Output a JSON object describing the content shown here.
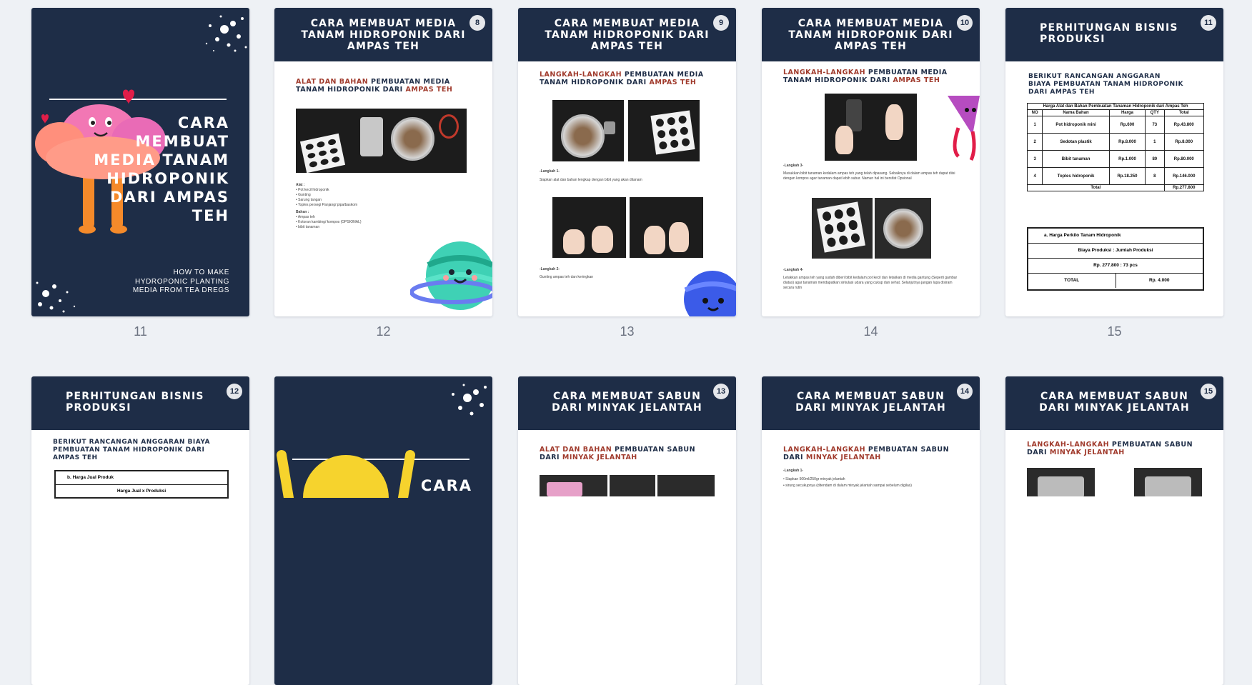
{
  "colors": {
    "navy": "#1e2d47",
    "accent_red": "#a03a2c",
    "background": "#eef1f5"
  },
  "page_numbers": [
    "11",
    "12",
    "13",
    "14",
    "15"
  ],
  "row1": {
    "cover": {
      "title_lines": [
        "CARA",
        "MEMBUAT",
        "MEDIA TANAM",
        "HIDROPONIK",
        "DARI AMPAS",
        "TEH"
      ],
      "subtitle_lines": [
        "HOW TO MAKE",
        "HYDROPONIC PLANTING",
        "MEDIA FROM TEA DREGS"
      ]
    },
    "p12": {
      "badge": "8",
      "title": "CARA MEMBUAT MEDIA TANAM HIDROPONIK DARI AMPAS TEH",
      "sub_red1": "ALAT DAN BAHAN",
      "sub_plain": " PEMBUATAN MEDIA TANAM HIDROPONIK DARI ",
      "sub_red2": "AMPAS TEH",
      "alat_label": "Alat :",
      "alat_items": [
        "• Pot kecil hidroponik",
        "• Gunting",
        "• Sarung tangan",
        "• Toples persegi Panjang/ pipa/baskom"
      ],
      "bahan_label": "Bahan :",
      "bahan_items": [
        "• Ampas teh",
        "• Kotoran kambing/ kompos (OPSIONAL)",
        "• bibit tanaman"
      ]
    },
    "p13": {
      "badge": "9",
      "title": "CARA MEMBUAT MEDIA TANAM HIDROPONIK DARI AMPAS TEH",
      "sub_red1": "LANGKAH-LANGKAH",
      "sub_plain": " PEMBUATAN MEDIA TANAM HIDROPONIK DARI ",
      "sub_red2": "AMPAS TEH",
      "step1": "-Langkah 1-",
      "step1_text": "Siapkan alat dan bahan lengkap dengan bibit yang akan ditanam",
      "step2": "-Langkah 2-",
      "step2_text": "Gunting ampas teh dan keringkan"
    },
    "p14": {
      "badge": "10",
      "title": "CARA MEMBUAT MEDIA TANAM HIDROPONIK DARI AMPAS TEH",
      "sub_red1": "LANGKAH-LANGKAH",
      "sub_plain": " PEMBUATAN MEDIA TANAM HIDROPONIK DARI ",
      "sub_red2": "AMPAS TEH",
      "step3": "-Langkah 3-",
      "step3_text": "Masukkan bibit tanaman kedalam ampas teh yang telah dipasang. Sebaiknya di dalam ampas teh dapat diisi dengan kompos agar tanaman dapat lebih subur. Namun hal ini bersifat Opsional",
      "step4": "-Langkah 4-",
      "step4_text": "Letakkan ampas teh yang sudah diberi bibit kedalam pot kecil dan letakkan di media gantung (Seperti gambar diatas) agar tanaman mendapatkan sirkulasi udara yang cukup dan sehat. Selanjutnya jangan lupa disiram secara rutin"
    },
    "p15": {
      "badge": "11",
      "title": "PERHITUNGAN BISNIS PRODUKSI",
      "subhead": "BERIKUT RANCANGAN ANGGARAN BIAYA PEMBUATAN TANAM HIDROPONIK DARI AMPAS TEH",
      "table_title": "Harga Alat dan Bahan Pembuatan Tanaman Hidroponik dari Ampas Teh",
      "columns": [
        "NO",
        "Nama Bahan",
        "Harga",
        "QTY",
        "Total"
      ],
      "rows": [
        [
          "1",
          "Pot hidroponik mini",
          "Rp.600",
          "73",
          "Rp.43.800"
        ],
        [
          "2",
          "Sedotan plastik",
          "Rp.8.000",
          "1",
          "Rp.8.000"
        ],
        [
          "3",
          "Bibit tanaman",
          "Rp.1.000",
          "80",
          "Rp.80.000"
        ],
        [
          "4",
          "Toples hidroponik",
          "Rp.18.250",
          "8",
          "Rp.146.000"
        ]
      ],
      "total_label": "Total",
      "total_value": "Rp.277.800",
      "box_a_title": "a. Harga Perkilo Tanam Hidroponik",
      "box_a_formula": "Biaya Produksi : Jumlah Produksi",
      "box_a_calc": "Rp. 277.800 : 73 pcs",
      "box_a_total_label": "TOTAL",
      "box_a_total_value": "Rp. 4.000"
    }
  },
  "row2": {
    "p1": {
      "badge": "12",
      "title": "PERHITUNGAN BISNIS PRODUKSI",
      "subhead": "BERIKUT RANCANGAN ANGGARAN BIAYA PEMBUATAN TANAM HIDROPONIK DARI AMPAS TEH",
      "box_b_title": "b. Harga Jual Produk",
      "box_b_formula": "Harga Jual x Produksi"
    },
    "p2": {
      "cover_word": "CARA"
    },
    "p3": {
      "badge": "13",
      "title": "CARA MEMBUAT SABUN DARI MINYAK JELANTAH",
      "sub_red1": "ALAT DAN BAHAN",
      "sub_plain": " PEMBUATAN SABUN DARI ",
      "sub_red2": "MINYAK JELANTAH"
    },
    "p4": {
      "badge": "14",
      "title": "CARA MEMBUAT SABUN DARI MINYAK JELANTAH",
      "sub_red1": "LANGKAH-LANGKAH",
      "sub_plain": " PEMBUATAN SABUN DARI ",
      "sub_red2": "MINYAK JELANTAH",
      "step1": "-Langkah 1-",
      "step1_text": "• Siapkan 500ml/250gr minyak jelantah",
      "step1_text2": "• sirung secukupnya (ditendam di dalam minyak jelantah sampai sebelum digilas)"
    },
    "p5": {
      "badge": "15",
      "title": "CARA MEMBUAT SABUN DARI MINYAK JELANTAH",
      "sub_red1": "LANGKAH-LANGKAH",
      "sub_plain": " PEMBUATAN SABUN DARI ",
      "sub_red2": "MINYAK JELANTAH"
    }
  }
}
